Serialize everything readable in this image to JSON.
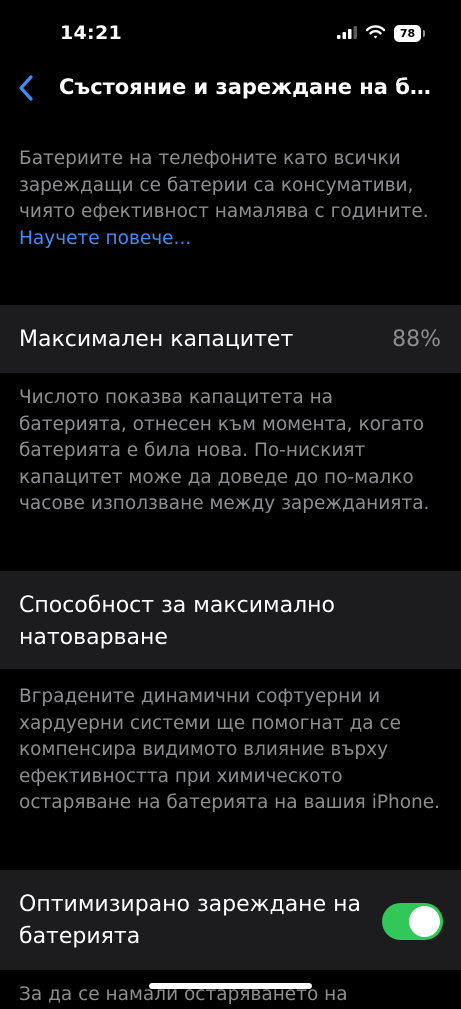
{
  "status_bar": {
    "time": "14:21",
    "battery_level": "78",
    "icons": [
      "signal-icon",
      "wifi-icon",
      "battery-icon"
    ]
  },
  "nav": {
    "back_icon": "chevron-left-icon",
    "title": "Състояние и зареждане на ба..."
  },
  "intro": {
    "text": "Батериите на телефоните като всички зареждащи се батерии са консумативи, чиято ефективност намалява с годините.",
    "learn_more": "Научете повече..."
  },
  "max_capacity": {
    "label": "Максимален капацитет",
    "value": "88%",
    "description": "Числото показва капацитета на батерията, отнесен към момента, когато батерията е била нова. По-ниският капацитет може да доведе до по-малко часове използване между зарежданията."
  },
  "peak_performance": {
    "label": "Способност за максимално натоварване",
    "description": "Вградените динамични софтуерни и хардуерни системи ще помогнат да се компенсира видимото влияние върху ефективността при химическото остаряване на батерията на вашия iPhone."
  },
  "optimized_charging": {
    "label": "Оптимизирано зареждане на батерията",
    "enabled": true,
    "description_partial": "За да се намали остаряването на"
  },
  "colors": {
    "background": "#000000",
    "cell_background": "#1c1c1e",
    "secondary_text": "#8d8d92",
    "link": "#3b8ef6",
    "toggle_on": "#32c759"
  }
}
